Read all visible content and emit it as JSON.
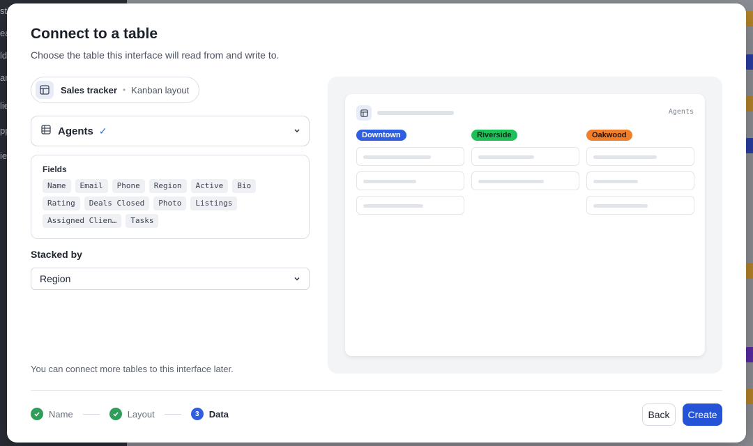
{
  "modal": {
    "title": "Connect to a table",
    "subtitle": "Choose the table this interface will read from and write to."
  },
  "source": {
    "name": "Sales tracker",
    "separator": "•",
    "layout": "Kanban layout"
  },
  "table_select": {
    "value": "Agents",
    "check": "✓"
  },
  "fields": {
    "label": "Fields",
    "items": [
      "Name",
      "Email",
      "Phone",
      "Region",
      "Active",
      "Bio",
      "Rating",
      "Deals Closed",
      "Photo",
      "Listings",
      "Assigned Clien…",
      "Tasks"
    ]
  },
  "stacked_by": {
    "label": "Stacked by",
    "value": "Region"
  },
  "note": "You can connect more tables to this interface later.",
  "preview": {
    "table_name": "Agents",
    "columns": [
      {
        "label": "Downtown",
        "bg": "#2f5fe0",
        "fg": "#ffffff"
      },
      {
        "label": "Riverside",
        "bg": "#1fc05a",
        "fg": "#0d2a16"
      },
      {
        "label": "Oakwood",
        "bg": "#f07f2c",
        "fg": "#2a1405"
      }
    ]
  },
  "stepper": {
    "steps": [
      {
        "label": "Name",
        "state": "done"
      },
      {
        "label": "Layout",
        "state": "done"
      },
      {
        "label": "Data",
        "state": "current",
        "number": "3"
      }
    ]
  },
  "buttons": {
    "back": "Back",
    "create": "Create"
  },
  "background": {
    "sidebar_fragments": [
      "sti",
      "ea",
      "ld",
      "ar",
      "lie",
      "pp",
      "ie"
    ]
  }
}
